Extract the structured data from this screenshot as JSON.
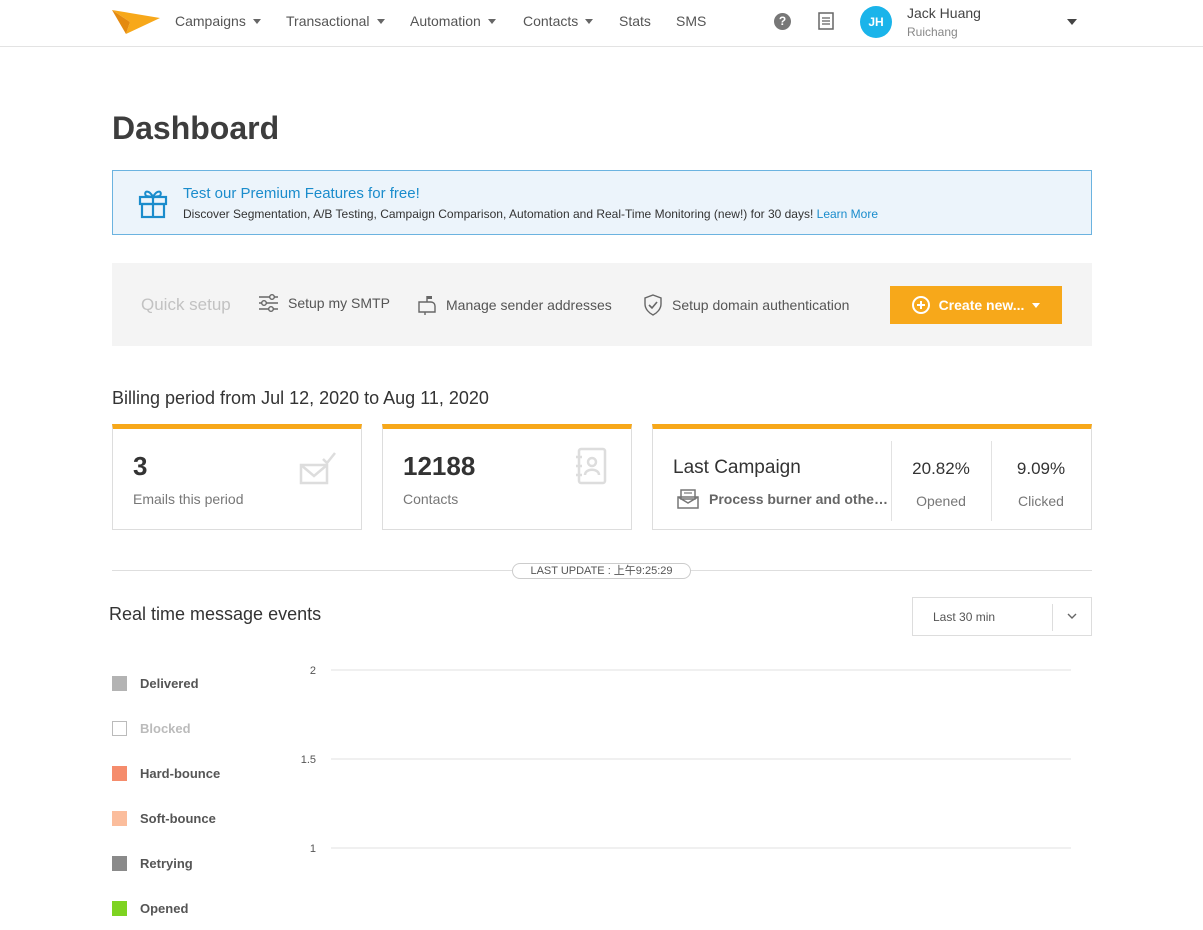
{
  "nav": {
    "items": [
      {
        "label": "Campaigns",
        "has_caret": true
      },
      {
        "label": "Transactional",
        "has_caret": true
      },
      {
        "label": "Automation",
        "has_caret": true
      },
      {
        "label": "Contacts",
        "has_caret": true
      },
      {
        "label": "Stats",
        "has_caret": false
      },
      {
        "label": "SMS",
        "has_caret": false
      }
    ],
    "help_icon": "question-circle-icon",
    "help_glyph": "?",
    "doc_icon": "document-icon",
    "user": {
      "initials": "JH",
      "name": "Jack Huang",
      "org": "Ruichang"
    }
  },
  "page": {
    "title": "Dashboard"
  },
  "banner": {
    "icon": "gift-icon",
    "title": "Test our Premium Features for free!",
    "text": "Discover Segmentation, A/B Testing, Campaign Comparison, Automation and Real-Time Monitoring (new!) for 30 days!",
    "link": "Learn More"
  },
  "quick_setup": {
    "label": "Quick setup",
    "items": [
      {
        "label": "Setup my SMTP",
        "icon": "sliders-icon"
      },
      {
        "label": "Manage sender addresses",
        "icon": "mailbox-icon"
      },
      {
        "label": "Setup domain authentication",
        "icon": "shield-check-icon"
      }
    ],
    "create_label": "Create new..."
  },
  "billing": {
    "label": "Billing period from Jul 12, 2020 to Aug 11, 2020",
    "cards": [
      {
        "value": "3",
        "label": "Emails this period",
        "icon": "envelope-check-icon"
      },
      {
        "value": "12188",
        "label": "Contacts",
        "icon": "address-book-icon"
      }
    ],
    "last_campaign": {
      "title": "Last Campaign",
      "name": "Process burner and other r...",
      "icon": "envelope-icon",
      "opened_value": "20.82%",
      "opened_label": "Opened",
      "clicked_value": "9.09%",
      "clicked_label": "Clicked"
    }
  },
  "last_update": "LAST UPDATE : 上午9:25:29",
  "realtime": {
    "title": "Real time message events",
    "range": "Last 30 min",
    "legend": [
      {
        "label": "Delivered",
        "color": "#b3b3b3",
        "hollow": false
      },
      {
        "label": "Blocked",
        "color": "#ffffff",
        "hollow": true
      },
      {
        "label": "Hard-bounce",
        "color": "#f58c6c",
        "hollow": false
      },
      {
        "label": "Soft-bounce",
        "color": "#fbbd9c",
        "hollow": false
      },
      {
        "label": "Retrying",
        "color": "#8a8a8a",
        "hollow": false
      },
      {
        "label": "Opened",
        "color": "#7ed321",
        "hollow": false
      }
    ]
  },
  "chart_data": {
    "type": "line",
    "title": "",
    "xlabel": "",
    "ylabel": "",
    "y_ticks": [
      "2",
      "1.5",
      "1"
    ],
    "ylim": [
      1,
      2
    ],
    "series": []
  }
}
